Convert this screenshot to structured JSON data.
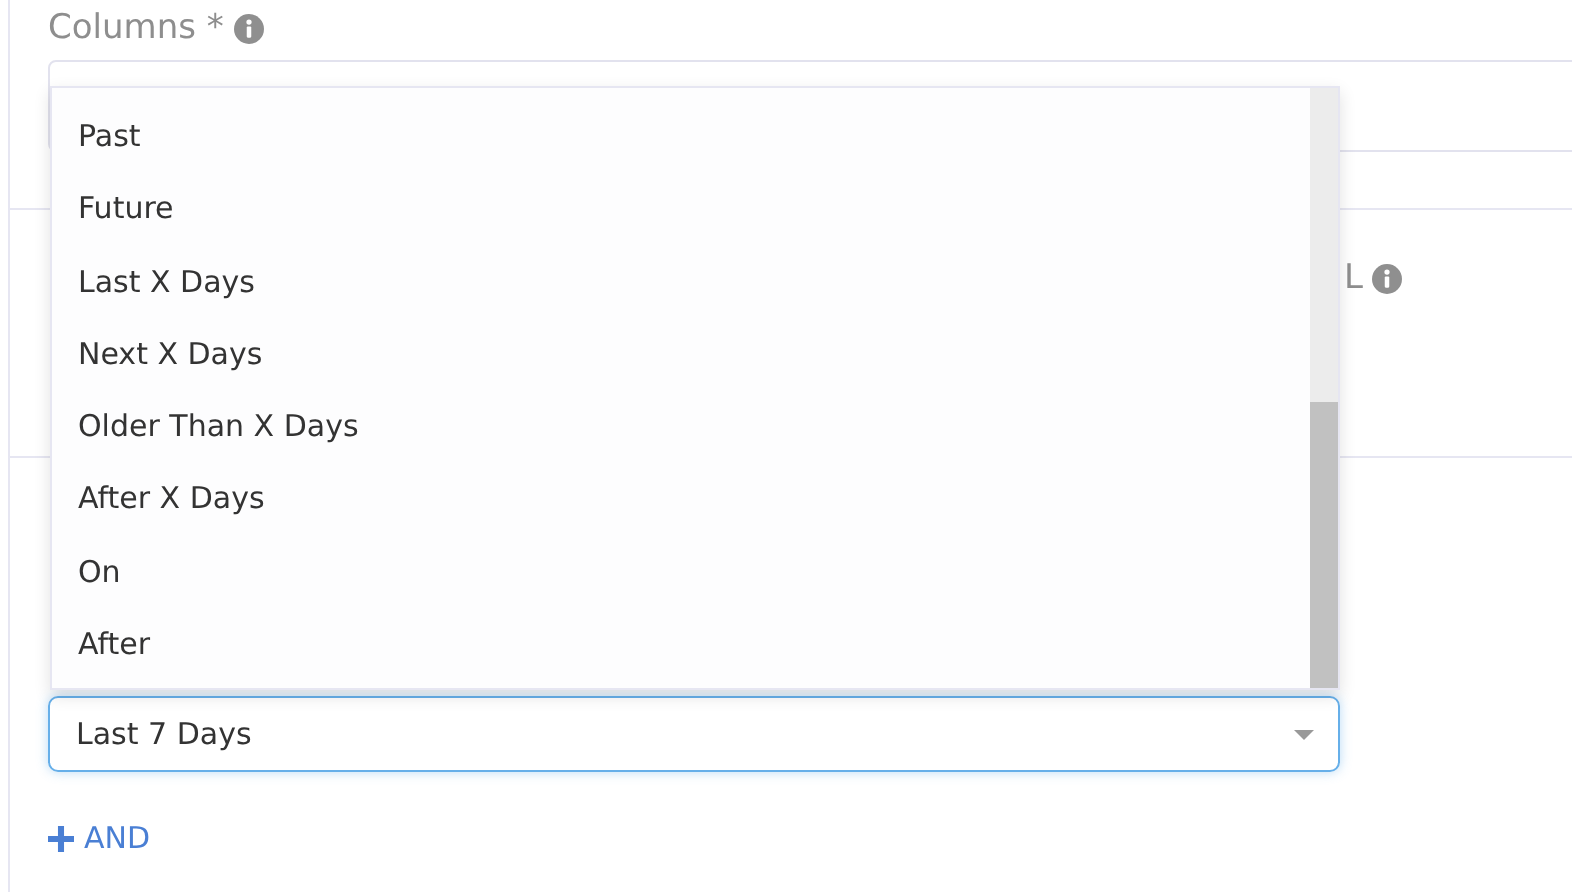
{
  "columns_field": {
    "label": "Columns *"
  },
  "second_field": {
    "label": "L"
  },
  "dropdown": {
    "options": [
      {
        "label": "Past"
      },
      {
        "label": "Future"
      },
      {
        "label": "Last X Days"
      },
      {
        "label": "Next X Days"
      },
      {
        "label": "Older Than X Days"
      },
      {
        "label": "After X Days"
      },
      {
        "label": "On"
      },
      {
        "label": "After"
      }
    ]
  },
  "filter_select": {
    "value": "Last 7 Days",
    "focused": true
  },
  "add_button": {
    "label": "AND"
  }
}
